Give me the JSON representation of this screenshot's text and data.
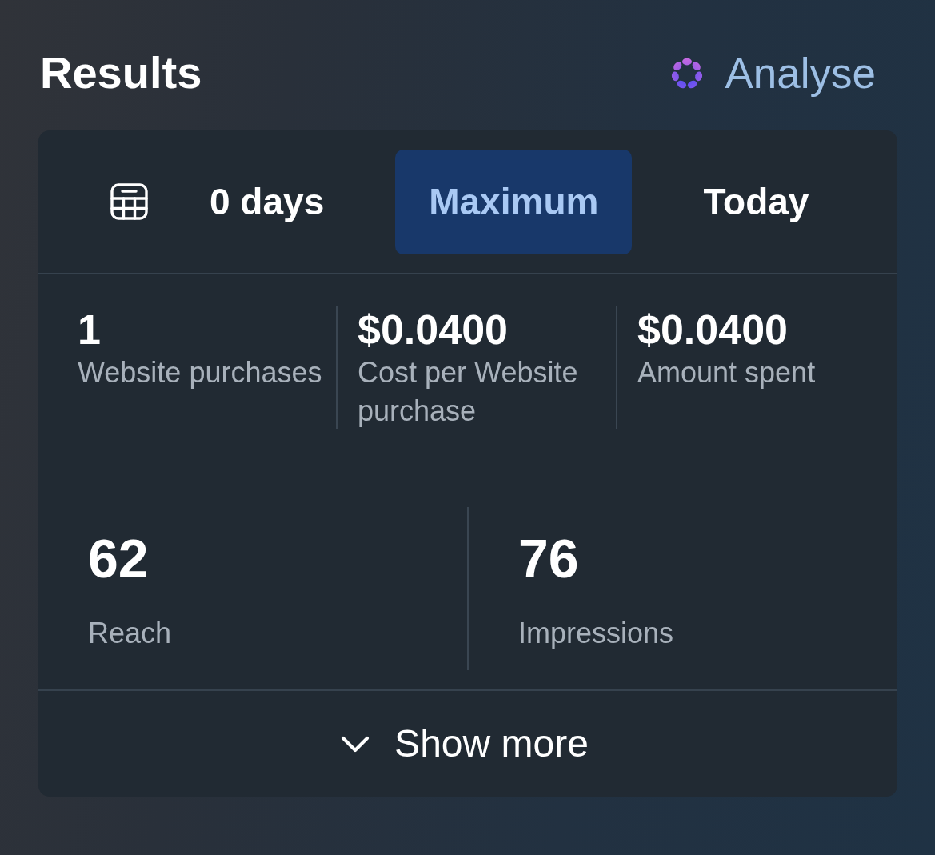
{
  "header": {
    "title": "Results",
    "action": {
      "label": "Analyse"
    }
  },
  "date_tabs": [
    {
      "label": "0 days",
      "selected": false
    },
    {
      "label": "Maximum",
      "selected": true
    },
    {
      "label": "Today",
      "selected": false
    }
  ],
  "metrics": [
    {
      "value": "1",
      "label": "Website purchases"
    },
    {
      "value": "$0.0400",
      "label": "Cost per Website purchase"
    },
    {
      "value": "$0.0400",
      "label": "Amount spent"
    }
  ],
  "summary": [
    {
      "value": "62",
      "label": "Reach"
    },
    {
      "value": "76",
      "label": "Impressions"
    }
  ],
  "footer": {
    "label": "Show more"
  }
}
